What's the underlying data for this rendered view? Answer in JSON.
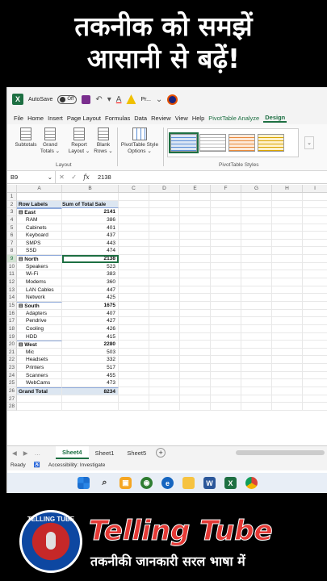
{
  "banner": {
    "line1": "तकनीक को समझें",
    "line2": "आसानी से बढ़ें!",
    "brand": "Telling Tube",
    "tagline": "तकनीकी जानकारी सरल भाषा में",
    "logo_text": "TELLING TUBE"
  },
  "titlebar": {
    "autosave_label": "AutoSave",
    "autosave_state": "Off",
    "doc_title": "Pr..."
  },
  "menu": [
    "File",
    "Home",
    "Insert",
    "Page Layout",
    "Formulas",
    "Data",
    "Review",
    "View",
    "Help",
    "PivotTable Analyze",
    "Design"
  ],
  "ribbon": {
    "subtotals": "Subtotals",
    "grand_totals_1": "Grand",
    "grand_totals_2": "Totals",
    "report_layout_1": "Report",
    "report_layout_2": "Layout",
    "blank_rows_1": "Blank",
    "blank_rows_2": "Rows",
    "style_options_1": "PivotTable Style",
    "style_options_2": "Options",
    "group_layout": "Layout",
    "group_styles": "PivotTable Styles"
  },
  "formula_bar": {
    "name_box": "B9",
    "value": "2138"
  },
  "columns": [
    "A",
    "B",
    "C",
    "D",
    "E",
    "F",
    "G",
    "H",
    "I"
  ],
  "pivot": {
    "header_row_labels": "Row Labels",
    "header_sum": "Sum of Total Sale",
    "rows": [
      {
        "n": "1",
        "label": "",
        "value": "",
        "kind": "blank"
      },
      {
        "n": "2",
        "label": "Row Labels",
        "value": "Sum of Total Sale",
        "kind": "hdr"
      },
      {
        "n": "3",
        "label": "⊟ East",
        "value": "2141",
        "kind": "region"
      },
      {
        "n": "4",
        "label": "RAM",
        "value": "386",
        "kind": "item"
      },
      {
        "n": "5",
        "label": "Cabinets",
        "value": "401",
        "kind": "item"
      },
      {
        "n": "6",
        "label": "Keyboard",
        "value": "437",
        "kind": "item"
      },
      {
        "n": "7",
        "label": "SMPS",
        "value": "443",
        "kind": "item"
      },
      {
        "n": "8",
        "label": "SSD",
        "value": "474",
        "kind": "item"
      },
      {
        "n": "9",
        "label": "⊟ North",
        "value": "2138",
        "kind": "region selected"
      },
      {
        "n": "10",
        "label": "Speakers",
        "value": "523",
        "kind": "item"
      },
      {
        "n": "11",
        "label": "Wi-Fi",
        "value": "383",
        "kind": "item"
      },
      {
        "n": "12",
        "label": "Modems",
        "value": "360",
        "kind": "item"
      },
      {
        "n": "13",
        "label": "LAN Cables",
        "value": "447",
        "kind": "item"
      },
      {
        "n": "14",
        "label": "Network",
        "value": "425",
        "kind": "item"
      },
      {
        "n": "15",
        "label": "⊟ South",
        "value": "1675",
        "kind": "region"
      },
      {
        "n": "16",
        "label": "Adapters",
        "value": "407",
        "kind": "item"
      },
      {
        "n": "17",
        "label": "Pendrive",
        "value": "427",
        "kind": "item"
      },
      {
        "n": "18",
        "label": "Cooling",
        "value": "426",
        "kind": "item"
      },
      {
        "n": "19",
        "label": "HDD",
        "value": "415",
        "kind": "item"
      },
      {
        "n": "20",
        "label": "⊟ West",
        "value": "2280",
        "kind": "region"
      },
      {
        "n": "21",
        "label": "Mic",
        "value": "503",
        "kind": "item"
      },
      {
        "n": "22",
        "label": "Headsets",
        "value": "332",
        "kind": "item"
      },
      {
        "n": "23",
        "label": "Printers",
        "value": "517",
        "kind": "item"
      },
      {
        "n": "24",
        "label": "Scanners",
        "value": "455",
        "kind": "item"
      },
      {
        "n": "25",
        "label": "WebCams",
        "value": "473",
        "kind": "item"
      },
      {
        "n": "26",
        "label": "Grand Total",
        "value": "8234",
        "kind": "total"
      },
      {
        "n": "27",
        "label": "",
        "value": "",
        "kind": "blank"
      },
      {
        "n": "28",
        "label": "",
        "value": "",
        "kind": "blank"
      }
    ]
  },
  "sheets": {
    "tabs": [
      "Sheet4",
      "Sheet1",
      "Sheet5"
    ],
    "active": "Sheet4"
  },
  "status": {
    "ready": "Ready",
    "accessibility": "Accessibility: Investigate"
  },
  "colors": {
    "excel_green": "#1d6f42",
    "pivot_header": "#dce6f1"
  }
}
